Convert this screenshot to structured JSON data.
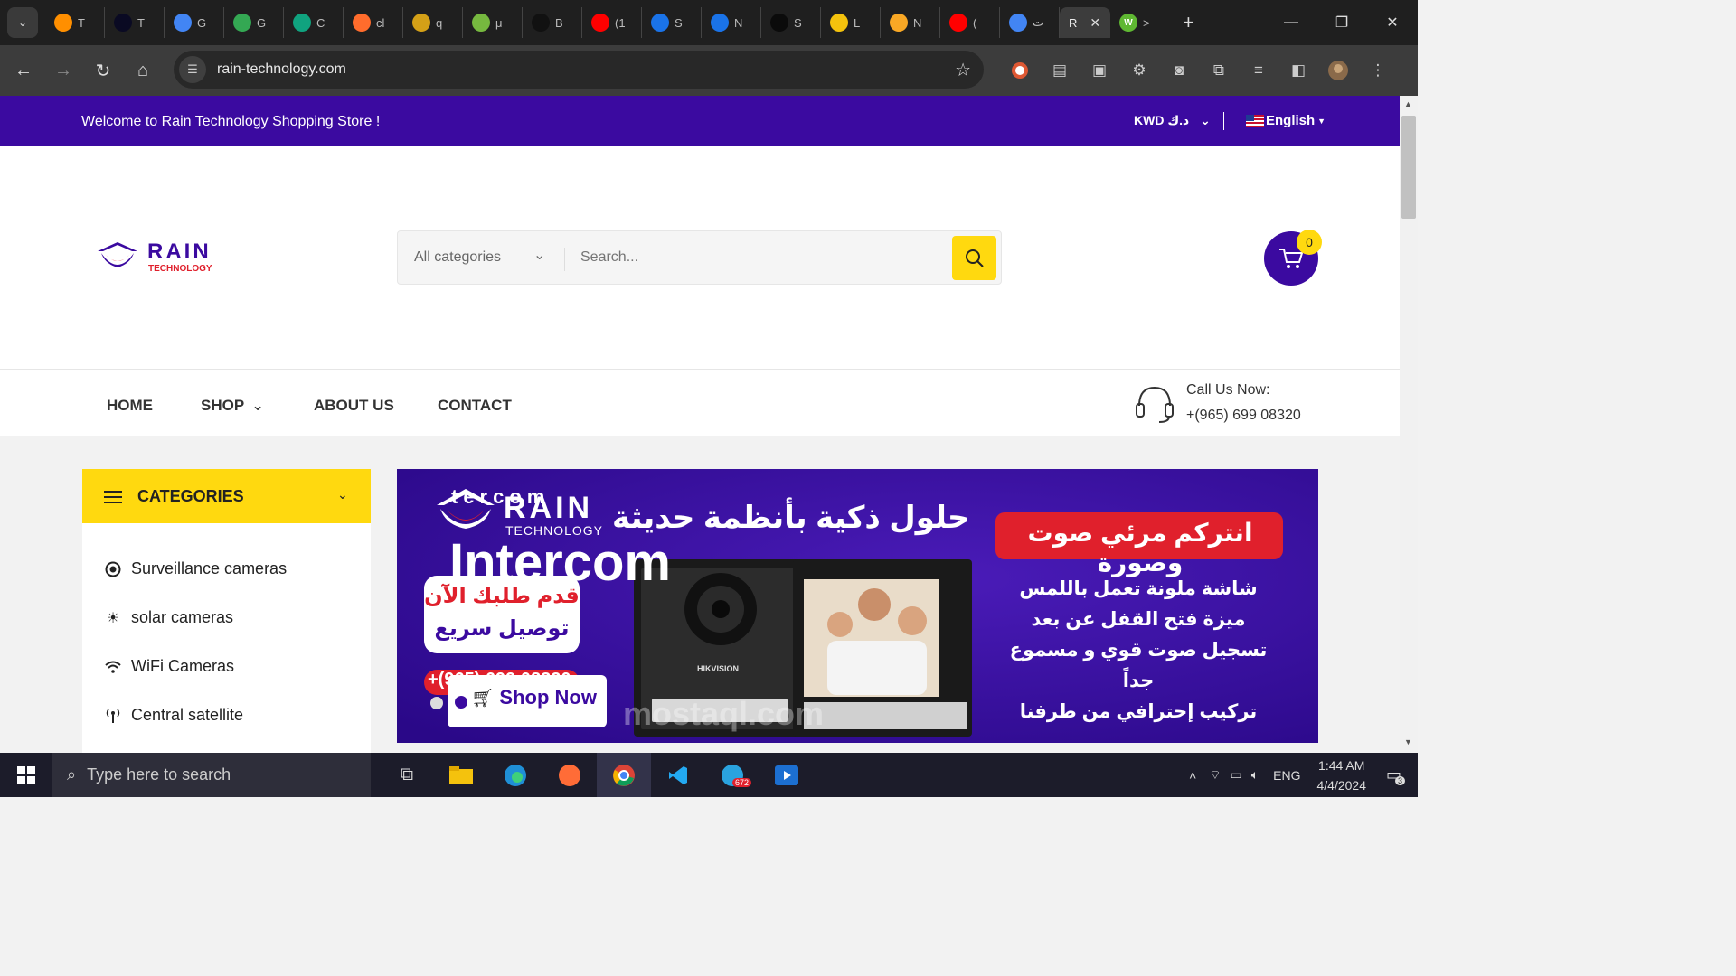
{
  "browser": {
    "tabs": [
      {
        "icon": "tensorflow-icon",
        "label": "T",
        "color": "#ff8f00"
      },
      {
        "icon": "freecodecamp-icon",
        "label": "T",
        "color": "#0a0a23"
      },
      {
        "icon": "google-icon",
        "label": "G",
        "color": "#4285f4"
      },
      {
        "icon": "google-colors-icon",
        "label": "G",
        "color": "#34a853"
      },
      {
        "icon": "chatgpt-icon",
        "label": "C",
        "color": "#10a37f"
      },
      {
        "icon": "cpanel-icon",
        "label": "cl",
        "color": "#ff6c2c"
      },
      {
        "icon": "mountain-icon",
        "label": "q",
        "color": "#d4a017"
      },
      {
        "icon": "utorrent-icon",
        "label": "μ",
        "color": "#76b83f"
      },
      {
        "icon": "brand-icon",
        "label": "B",
        "color": "#111111"
      },
      {
        "icon": "youtube-icon",
        "label": "(1",
        "color": "#ff0000"
      },
      {
        "icon": "c-icon",
        "label": "S",
        "color": "#1a73e8"
      },
      {
        "icon": "c-icon",
        "label": "N",
        "color": "#1a73e8"
      },
      {
        "icon": "hi-icon",
        "label": "S",
        "color": "#0b0b0b"
      },
      {
        "icon": "chat-bubble-icon",
        "label": "L",
        "color": "#f4c20d"
      },
      {
        "icon": "mango-icon",
        "label": "N",
        "color": "#f9a825"
      },
      {
        "icon": "youtube-icon",
        "label": "(",
        "color": "#ff0000"
      },
      {
        "icon": "translate-icon",
        "label": "ت",
        "color": "#4285f4"
      }
    ],
    "active_tab": {
      "label": "R",
      "close": "✕"
    },
    "extra_tab": {
      "icon": "w-icon",
      "label": ">",
      "color": "#5fb832"
    },
    "new_tab": "+",
    "url": "rain-technology.com"
  },
  "site": {
    "welcome": "Welcome to Rain Technology Shopping Store !",
    "currency": "KWD د.ك",
    "language": "English",
    "logo_text": "RAIN",
    "logo_sub": "TECHNOLOGY",
    "search": {
      "category": "All categories",
      "placeholder": "Search..."
    },
    "cart_count": "0",
    "nav": [
      {
        "label": "HOME"
      },
      {
        "label": "SHOP"
      },
      {
        "label": "ABOUT US"
      },
      {
        "label": "CONTACT"
      }
    ],
    "call_label": "Call Us Now:",
    "call_number": "+(965) 699 08320",
    "categories_title": "CATEGORIES",
    "categories": [
      {
        "label": "Surveillance cameras",
        "icon": "target-icon"
      },
      {
        "label": "solar cameras",
        "icon": "sun-icon"
      },
      {
        "label": "WiFi Cameras",
        "icon": "wifi-icon"
      },
      {
        "label": "Central satellite",
        "icon": "antenna-icon"
      }
    ],
    "banner": {
      "overlay_word": "tercom",
      "brand": "RAIN",
      "brand_sub": "TECHNOLOGY",
      "title": "Intercom",
      "headline_ar": "حلول ذكية بأنظمة حديثة",
      "red_badge_ar": "انتركم مرئي صوت وصورة",
      "order_ar_1": "قدم طلبك الآن",
      "order_ar_2": "توصيل سريع",
      "features_ar": [
        "شاشة ملونة تعمل باللمس",
        "ميزة فتح القفل عن بعد",
        "تسجيل صوت قوي و مسموع جداً",
        "تركيب إحترافي من طرفنا"
      ],
      "phone_partial": "+(965) 699 08320",
      "device_brand": "HIKVISION",
      "cta": "Shop Now",
      "watermark": "mostaql.com"
    }
  },
  "taskbar": {
    "search_placeholder": "Type here to search",
    "lang": "ENG",
    "time": "1:44 AM",
    "date": "4/4/2024",
    "notif_count": "3",
    "telegram_badge": "672"
  }
}
